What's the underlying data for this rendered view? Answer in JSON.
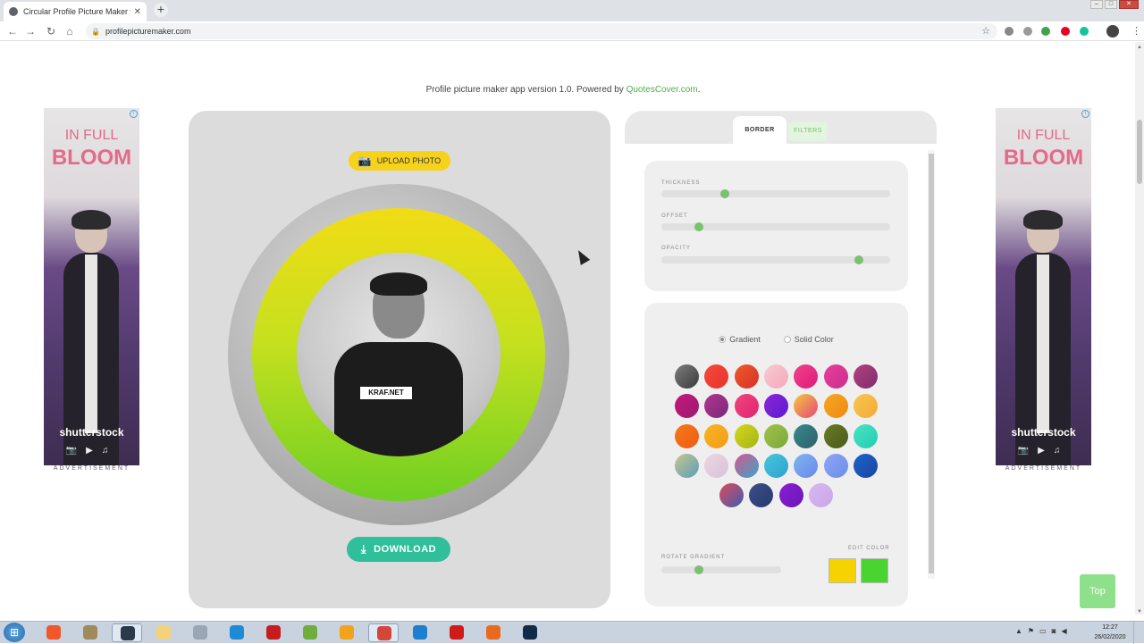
{
  "browser": {
    "tab_title": "Circular Profile Picture Maker wi",
    "url": "profilepicturemaker.com",
    "new_tab_icon": "+",
    "close_tab_icon": "✕"
  },
  "page": {
    "powered_text": "Profile picture maker app version 1.0. Powered by ",
    "powered_link": "QuotesCover.com",
    "powered_end": "."
  },
  "ads": {
    "left": {
      "line1": "IN FULL",
      "line2": "BLOOM",
      "brand": "shutterstock",
      "label": "ADVERTISEMENT"
    },
    "right": {
      "line1": "IN FULL",
      "line2": "BLOOM",
      "brand": "shutterstock",
      "label": "ADVERTISEMENT"
    }
  },
  "preview": {
    "upload_label": "UPLOAD PHOTO",
    "download_label": "DOWNLOAD",
    "shirt_logo": "KRAF.NET"
  },
  "controls": {
    "tabs": {
      "border": "BORDER",
      "filters": "FILTERS"
    },
    "sliders": [
      {
        "label": "THICKNESS",
        "value": 0.27
      },
      {
        "label": "OFFSET",
        "value": 0.15
      },
      {
        "label": "OPACITY",
        "value": 0.88
      }
    ],
    "radio_gradient": "Gradient",
    "radio_solid": "Solid Color",
    "selected_mode": "Gradient",
    "swatches": [
      [
        "#7d7d7d",
        "#3a3a3a"
      ],
      [
        "#f24b3a",
        "#e8322c"
      ],
      [
        "#f05a28",
        "#d6302a"
      ],
      [
        "#f9c9d4",
        "#f3a9b8"
      ],
      [
        "#f0438a",
        "#e0197a"
      ],
      [
        "#e83f9b",
        "#c92e8c"
      ],
      [
        "#b7407f",
        "#7d2d6e"
      ],
      [
        "#c4177a",
        "#9b1c72"
      ],
      [
        "#b03590",
        "#7a2a78"
      ],
      [
        "#f0457f",
        "#e02470"
      ],
      [
        "#8f25d8",
        "#5a1ad0"
      ],
      [
        "#f3c83e",
        "#e8457a"
      ],
      [
        "#f6a623",
        "#ee8a10"
      ],
      [
        "#f7c84a",
        "#f3a93b"
      ],
      [
        "#f57a1a",
        "#ee5b12"
      ],
      [
        "#f8b625",
        "#f09a18"
      ],
      [
        "#d6d61d",
        "#a2b516"
      ],
      [
        "#a2c14b",
        "#7aa83a"
      ],
      [
        "#3a8a8e",
        "#2c5f6a"
      ],
      [
        "#6a7a26",
        "#4b5a1a"
      ],
      [
        "#4ae3c6",
        "#22cdb0"
      ],
      [
        "#c7c58d",
        "#5b9fb7"
      ],
      [
        "#e9d5e1",
        "#d8c4da"
      ],
      [
        "#d6588d",
        "#3aa4c9"
      ],
      [
        "#48c5db",
        "#2ea2d0"
      ],
      [
        "#7db7f0",
        "#6a86e8"
      ],
      [
        "#8fa7f5",
        "#6b8ce8"
      ],
      [
        "#1f64c9",
        "#1945a2"
      ],
      [
        "#e04b5c",
        "#3f5bb0"
      ],
      [
        "#3a4f86",
        "#2a3870"
      ],
      [
        "#8a1fd3",
        "#6a16b8"
      ],
      [
        "#d7b8f0",
        "#c9a6ea"
      ]
    ],
    "rotate_label": "ROTATE GRADIENT",
    "rotate_value": 0.3,
    "edit_label": "EDIT COLOR",
    "edit_colors": [
      "#f6d200",
      "#4ad42f"
    ]
  },
  "top_button": "Top",
  "taskbar": {
    "time": "12:27",
    "date": "26/02/2020"
  }
}
